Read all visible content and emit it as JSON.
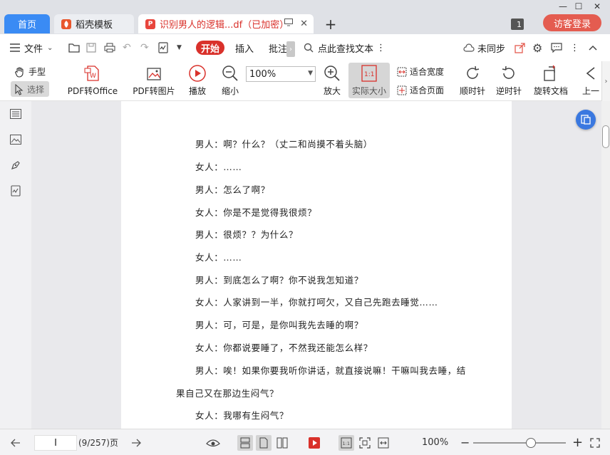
{
  "tabs": {
    "home": "首页",
    "template": "稻壳模板",
    "document": "识别男人的逻辑...df（已加密）"
  },
  "header": {
    "badge": "1",
    "login": "访客登录"
  },
  "menu": {
    "file": "文件",
    "start": "开始",
    "insert": "插入",
    "annotate": "批注",
    "search": "点此查找文本",
    "sync": "未同步"
  },
  "toolbar": {
    "hand": "手型",
    "select": "选择",
    "pdf_office": "PDF转Office",
    "pdf_image": "PDF转图片",
    "play": "播放",
    "zoom_out": "缩小",
    "zoom_value": "100%",
    "zoom_in": "放大",
    "actual_size": "实际大小",
    "actual_size_icon_text": "1:1",
    "fit_width": "适合宽度",
    "fit_page": "适合页面",
    "clockwise": "顺时针",
    "counterclockwise": "逆时针",
    "rotate": "旋转文档",
    "prev": "上一"
  },
  "document": {
    "lines": [
      "男人：啊？什么？（丈二和尚摸不着头脑）",
      "女人：……",
      "男人：怎么了啊？",
      "女人：你是不是觉得我很烦？",
      "男人：很烦？？为什么？",
      "女人：……",
      "男人：到底怎么了啊？你不说我怎知道？",
      "女人：人家讲到一半，你就打呵欠，又自己先跑去睡觉……",
      "男人：可，可是，是你叫我先去睡的啊？",
      "女人：你都说要睡了，不然我还能怎么样？",
      "男人：唉！如果你要我听你讲话，就直接说嘛！干嘛叫我去睡，结",
      "果自己又在那边生闷气？",
      "女人：我哪有生闷气？"
    ]
  },
  "status": {
    "page_input": "I",
    "page_info": "(9/257)页",
    "zoom": "100%"
  },
  "colors": {
    "accent_red": "#d9312b",
    "home_tab_blue": "#3a8bf4",
    "login_red": "#e45c50"
  }
}
